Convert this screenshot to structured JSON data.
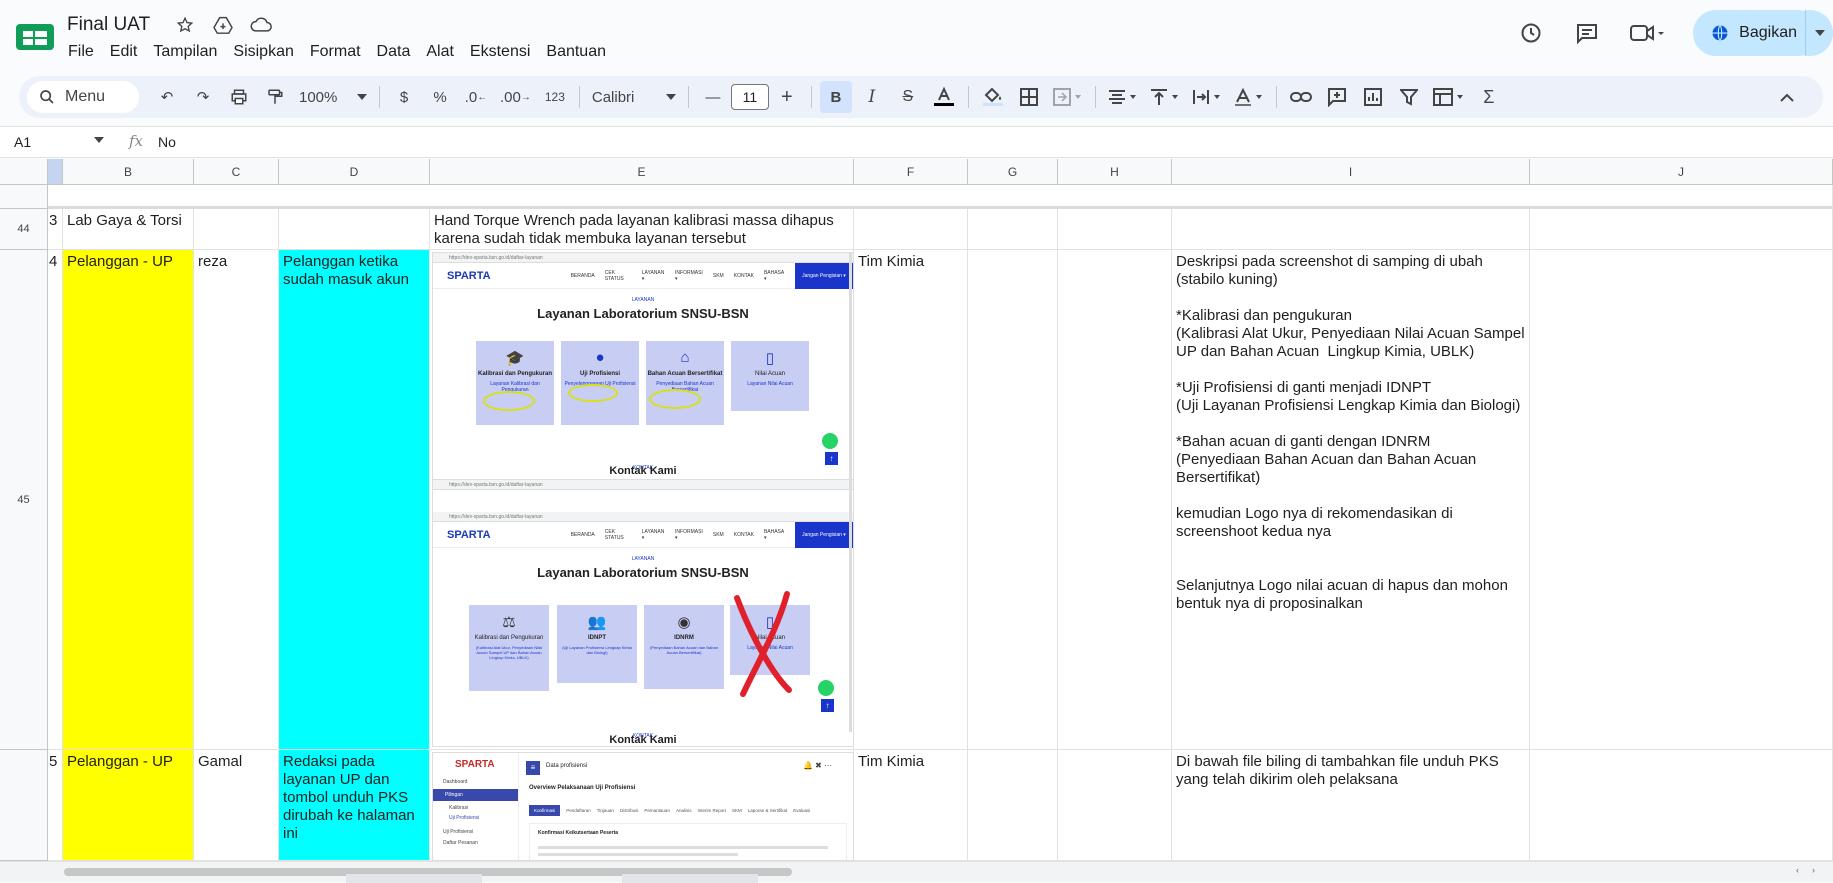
{
  "app": {
    "title": "Final UAT",
    "menu": [
      "File",
      "Edit",
      "Tampilan",
      "Sisipkan",
      "Format",
      "Data",
      "Alat",
      "Ekstensi",
      "Bantuan"
    ],
    "share_label": "Bagikan"
  },
  "toolbar": {
    "search_label": "Menu",
    "zoom": "100%",
    "currency": "$",
    "percent": "%",
    "decrease_decimal": ".0",
    "increase_decimal": ".00",
    "number_format": "123",
    "font": "Calibri",
    "font_size": "11",
    "bold": "B",
    "italic": "I"
  },
  "formula_bar": {
    "cell_ref": "A1",
    "fx": "fx",
    "value": "No"
  },
  "columns": [
    "B",
    "C",
    "D",
    "E",
    "F",
    "G",
    "H",
    "I",
    "J"
  ],
  "rows": [
    {
      "number": "44",
      "no": "3",
      "b": "Lab Gaya & Torsi",
      "c": "",
      "d": "",
      "e": "Hand Torque Wrench pada layanan kalibrasi massa dihapus karena sudah tidak membuka layanan tersebut",
      "f": "",
      "i": ""
    },
    {
      "number": "45",
      "no": "4",
      "b": "Pelanggan - UP",
      "c": "reza",
      "d": "Pelanggan ketika sudah masuk akun",
      "f": "Tim Kimia",
      "i": "Deskripsi pada screenshot di samping di ubah (stabilo kuning)\n\n*Kalibrasi dan pengukuran\n(Kalibrasi Alat Ukur, Penyediaan Nilai Acuan Sampel UP dan Bahan Acuan  Lingkup Kimia, UBLK)\n\n*Uji Profisiensi di ganti menjadi IDNPT\n(Uji Layanan Profisiensi Lengkap Kimia dan Biologi)\n\n*Bahan acuan di ganti dengan IDNRM\n(Penyediaan Bahan Acuan dan Bahan Acuan Bersertifikat)\n\nkemudian Logo nya di rekomendasikan di screenshoot kedua nya\n\n\nSelanjutnya Logo nilai acuan di hapus dan mohon bentuk nya di proposinalkan"
    },
    {
      "number": "",
      "no": "5",
      "b": "Pelanggan - UP",
      "c": "Gamal",
      "d": "Redaksi pada layanan UP dan tombol unduh PKS dirubah ke halaman ini",
      "f": "Tim Kimia",
      "i": "Di bawah file biling di tambahkan file unduh PKS yang telah dikirim oleh pelaksana"
    }
  ],
  "screenshot1": {
    "url": "https://dev-sparta.bsn.go.id/daftar-layanan",
    "brand": "SPARTA",
    "nav": [
      "BERANDA",
      "CEK STATUS",
      "LAYANAN ▾",
      "INFORMASI ▾",
      "SKM",
      "KONTAK",
      "BAHASA ▾"
    ],
    "login": "Jangan Pengisian ▾",
    "section_tag": "LAYANAN",
    "section_title": "Layanan Laboratorium SNSU-BSN",
    "cards": [
      {
        "title": "Kalibrasi dan Pengukuran",
        "sub": "Layanan Kalibrasi dan Pengukuran"
      },
      {
        "title": "Uji Profisiensi",
        "sub": "Penyelenggaraan Uji Profisiensi"
      },
      {
        "title": "Bahan Acuan Bersertifikat",
        "sub": "Penyediaan Bahan Acuan Bersertifikat"
      },
      {
        "title": "Nilai Acuan",
        "sub": "Layanan Nilai Acuan"
      }
    ],
    "footer_tag": "KONTAK",
    "footer_title": "Kontak Kami"
  },
  "screenshot2": {
    "url": "https://dev-sparta.bsn.go.id/daftar-layanan",
    "brand": "SPARTA",
    "nav": [
      "BERANDA",
      "CEK STATUS",
      "LAYANAN ▾",
      "INFORMASI ▾",
      "SKM",
      "KONTAK",
      "BAHASA ▾"
    ],
    "login": "Jangan Pengisian ▾",
    "section_tag": "LAYANAN",
    "section_title": "Layanan Laboratorium SNSU-BSN",
    "cards": [
      {
        "title": "Kalibrasi dan Pengukuran",
        "sub": "(Kalibrasi Alat Ukur, Penyediaan Nilai Acuan Sampel UP dan Bahan Acuan Lingkup Kimia, UBLK)"
      },
      {
        "title": "IDNPT",
        "sub": "(Uji Layanan Profisiensi Lengkap Kimia dan Biologi)"
      },
      {
        "title": "IDNRM",
        "sub": "(Penyediaan Bahan Acuan dan Bahan Acuan Bersertifikat)"
      },
      {
        "title": "Nilai Acuan",
        "sub": "Layanan Nilai Acuan"
      }
    ],
    "footer_tag": "KONTAK",
    "footer_title": "Kontak Kami"
  },
  "screenshot3": {
    "brand": "SPARTA",
    "page_title": "Data profisiensi",
    "sidebar": [
      "Dashboard",
      "Pilingan",
      "Kalibrasi",
      "Uji Profisiensi",
      "Uji Profisiensi",
      "Daftar Pesanan"
    ],
    "heading": "Overview Pelaksanaan Uji Profisiensi",
    "tabs": [
      "Konfirmasi",
      "Pendaftaran",
      "Tinjauan",
      "Distribusi",
      "Pemantauan",
      "Analisis",
      "Interim Report",
      "SKM",
      "Laporan & Sertifikat",
      "Evaluasi"
    ],
    "panel_title": "Konfirmasi Keikutsertaan Peserta"
  },
  "colors": {
    "yellow": "#ffff00",
    "cyan": "#00ffff",
    "share_bg": "#c2e7ff",
    "toolbar_bg": "#edf2fa",
    "brand_blue": "#1a35c9"
  }
}
